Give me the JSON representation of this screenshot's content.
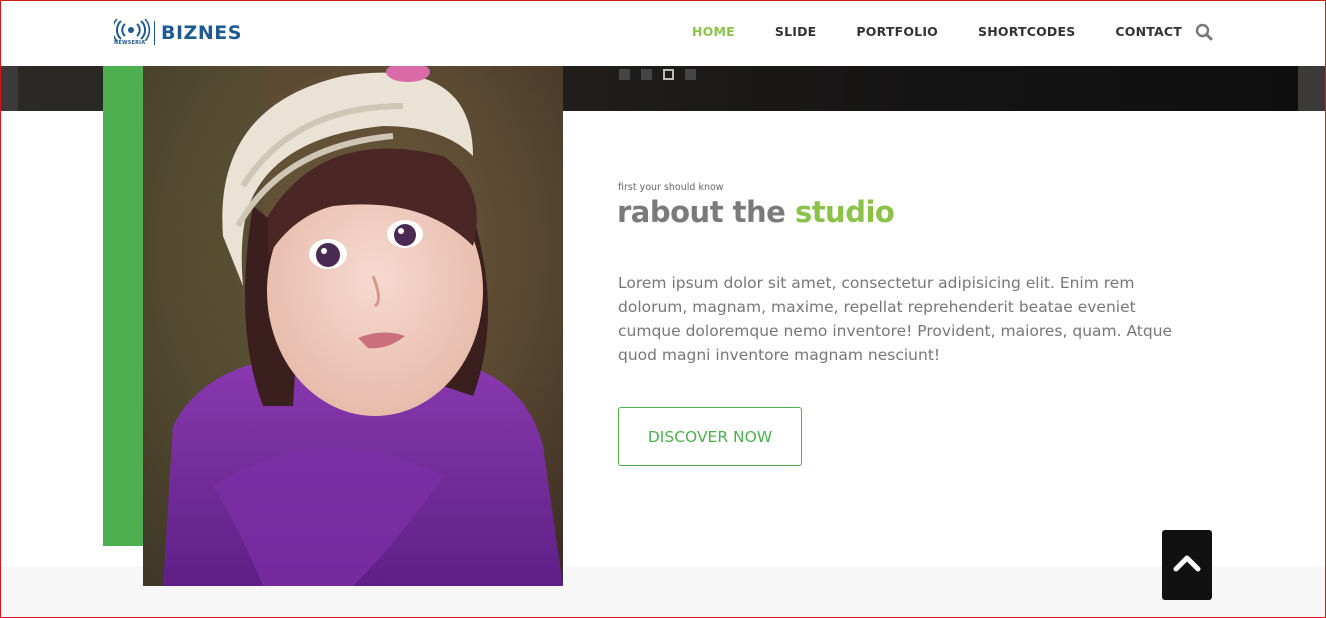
{
  "brand": {
    "logo_text": "BIZNES",
    "logo_sub": "NEWSERIA",
    "primary_color": "#1d5a92",
    "accent_color": "#8bc34a",
    "green_color": "#4caf50"
  },
  "nav": {
    "items": [
      {
        "label": "HOME",
        "active": true
      },
      {
        "label": "SLIDE",
        "active": false
      },
      {
        "label": "PORTFOLIO",
        "active": false
      },
      {
        "label": "SHORTCODES",
        "active": false
      },
      {
        "label": "CONTACT",
        "active": false
      }
    ],
    "search_icon": "search-icon"
  },
  "slider": {
    "dots": 4,
    "active_dot": 3
  },
  "about": {
    "kicker": "first your should know",
    "headline_main": "rabout the ",
    "headline_accent": "studio",
    "body": "Lorem ipsum dolor sit amet, consectetur adipisicing elit. Enim rem dolorum, magnam, maxime, repellat reprehenderit beatae eveniet cumque doloremque nemo inventore! Provident, maiores, quam. Atque quod magni inventore magnam nesciunt!",
    "cta_label": "DISCOVER NOW",
    "photo_icon": "child-portrait-image"
  },
  "scroll_top": {
    "icon": "chevron-up-icon"
  }
}
